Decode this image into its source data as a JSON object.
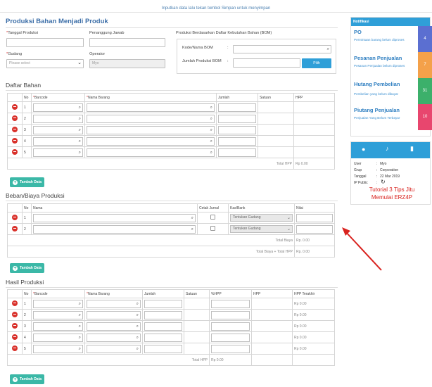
{
  "topbar": {
    "message": "Inputkan data lalu tekan tombol Simpan untuk menyimpan"
  },
  "form": {
    "title": "Produksi Bahan Menjadi Produk",
    "tanggal_label": "Tanggal Produksi",
    "penanggung_label": "Penanggung Jawab",
    "gudang_label": "Gudang",
    "gudang_value": "Please select",
    "operator_label": "Operator",
    "operator_value": "Myo",
    "bom_title": "Produksi Berdasarkan Daftar Kebutuhan Bahan (BOM)",
    "bom_kode_label": "Kode/Nama BOM",
    "bom_jumlah_label": "Jumlah Produksi BOM",
    "bom_colon": ":",
    "bom_button": "Pilih"
  },
  "bahan": {
    "title": "Daftar Bahan",
    "headers": [
      "No",
      "Barcode",
      "Nama Barang",
      "Jumlah",
      "Satuan",
      "HPP"
    ],
    "rows": [
      "1",
      "2",
      "3",
      "4",
      "5"
    ],
    "total_label": "Total HPP",
    "total_value": "Rp 0.00",
    "add_label": "Tambah Data"
  },
  "beban": {
    "title": "Beban/Biaya Produksi",
    "headers": [
      "No",
      "Nama",
      "Cetak Jurnal",
      "Kas/Bank",
      "Nilai"
    ],
    "rows": [
      "1",
      "2"
    ],
    "kas_placeholder": "Tentukan Gudang",
    "total_biaya_label": "Total Biaya",
    "total_biaya_value": "Rp. 0.00",
    "total_all_label": "Total Biaya + Total HPP",
    "total_all_value": "Rp. 0.00",
    "add_label": "Tambah Data"
  },
  "hasil": {
    "title": "Hasil Produksi",
    "headers": [
      "No",
      "Barcode",
      "Nama Barang",
      "Jumlah",
      "Satuan",
      "%HPP",
      "HPP",
      "HPP Terakhir"
    ],
    "rows": [
      "1",
      "2",
      "3",
      "4",
      "5"
    ],
    "row_value": "Rp 0.00",
    "total_label": "Total HPP",
    "total_value": "Rp 0.00",
    "add_label": "Tambah Data"
  },
  "notifikasi": {
    "title": "Notifikasi",
    "items": [
      {
        "title": "PO",
        "desc": "Permintaan barang belum diproses",
        "count": "4",
        "color": "#5b6fd1"
      },
      {
        "title": "Pesanan Penjualan",
        "desc": "Pesanan Penjualan belum diproses",
        "count": "7",
        "color": "#f4a14a"
      },
      {
        "title": "Hutang Pembelian",
        "desc": "Pembelian yang belum dibayar",
        "count": "31",
        "color": "#3cb06b"
      },
      {
        "title": "Piutang Penjualan",
        "desc": "Penjualan Yang Belum Terbayar",
        "count": "10",
        "color": "#e8466e"
      }
    ]
  },
  "user": {
    "user_label": "User",
    "user_value": "Myo",
    "grup_label": "Grup",
    "grup_value": "Corporation",
    "tanggal_label": "Tanggal",
    "tanggal_value": "22 Mar 2019",
    "ip_label": "IP Public",
    "promo": "Tutorial 3 Tips Jitu Memulai ERZ4P",
    "colon": ":"
  },
  "colors": {
    "accent": "#2f9fd8",
    "danger": "#d9312b",
    "add_button": "#3bb8a7",
    "arrow": "#d9231f"
  }
}
